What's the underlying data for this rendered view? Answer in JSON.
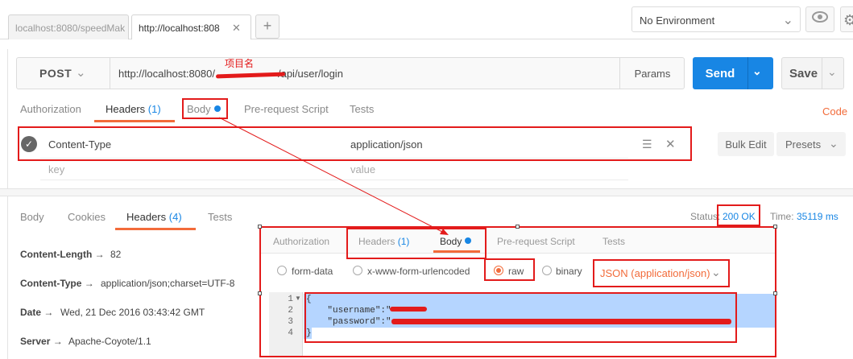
{
  "tabs": [
    {
      "label": "localhost:8080/speedMak"
    },
    {
      "label": "http://localhost:808"
    }
  ],
  "tab_add": "+",
  "environment": {
    "label": "No Environment"
  },
  "request": {
    "method": "POST",
    "url": "http://localhost:8080/",
    "url_tail": "/api/user/login",
    "params_label": "Params",
    "send_label": "Send",
    "save_label": "Save"
  },
  "annotation": {
    "project_name_label": "项目名"
  },
  "request_tabs": [
    {
      "label": "Authorization"
    },
    {
      "label": "Headers",
      "count": "(1)"
    },
    {
      "label": "Body"
    },
    {
      "label": "Pre-request Script"
    },
    {
      "label": "Tests"
    }
  ],
  "code_link": "Code",
  "headers_editor": {
    "rows": [
      {
        "key": "Content-Type",
        "value": "application/json"
      }
    ],
    "key_placeholder": "key",
    "value_placeholder": "value",
    "bulk_edit_label": "Bulk Edit",
    "presets_label": "Presets"
  },
  "response": {
    "tabs": [
      {
        "label": "Body"
      },
      {
        "label": "Cookies"
      },
      {
        "label": "Headers",
        "count": "(4)"
      },
      {
        "label": "Tests"
      }
    ],
    "status_label": "Status:",
    "status_value": "200 OK",
    "time_label": "Time:",
    "time_value": "35119 ms",
    "headers": [
      {
        "key": "Content-Length →",
        "value": "82"
      },
      {
        "key": "Content-Type →",
        "value": "application/json;charset=UTF-8"
      },
      {
        "key": "Date →",
        "value": "Wed, 21 Dec 2016 03:43:42 GMT"
      },
      {
        "key": "Server →",
        "value": "Apache-Coyote/1.1"
      }
    ]
  },
  "inset": {
    "tabs": [
      {
        "label": "Authorization"
      },
      {
        "label": "Headers",
        "count": "(1)"
      },
      {
        "label": "Body"
      },
      {
        "label": "Pre-request Script"
      },
      {
        "label": "Tests"
      }
    ],
    "body_types": [
      {
        "label": "form-data",
        "selected": false
      },
      {
        "label": "x-www-form-urlencoded",
        "selected": false
      },
      {
        "label": "raw",
        "selected": true
      },
      {
        "label": "binary",
        "selected": false
      }
    ],
    "content_type": "JSON (application/json)",
    "code_lines": [
      "{",
      "    \"username\":\"",
      "    \"password\":\"",
      "}"
    ],
    "line_numbers": [
      "1",
      "2",
      "3",
      "4"
    ]
  },
  "colors": {
    "accent_blue": "#1886e4",
    "accent_orange": "#f26b3a",
    "annotation_red": "#e31b1b"
  }
}
